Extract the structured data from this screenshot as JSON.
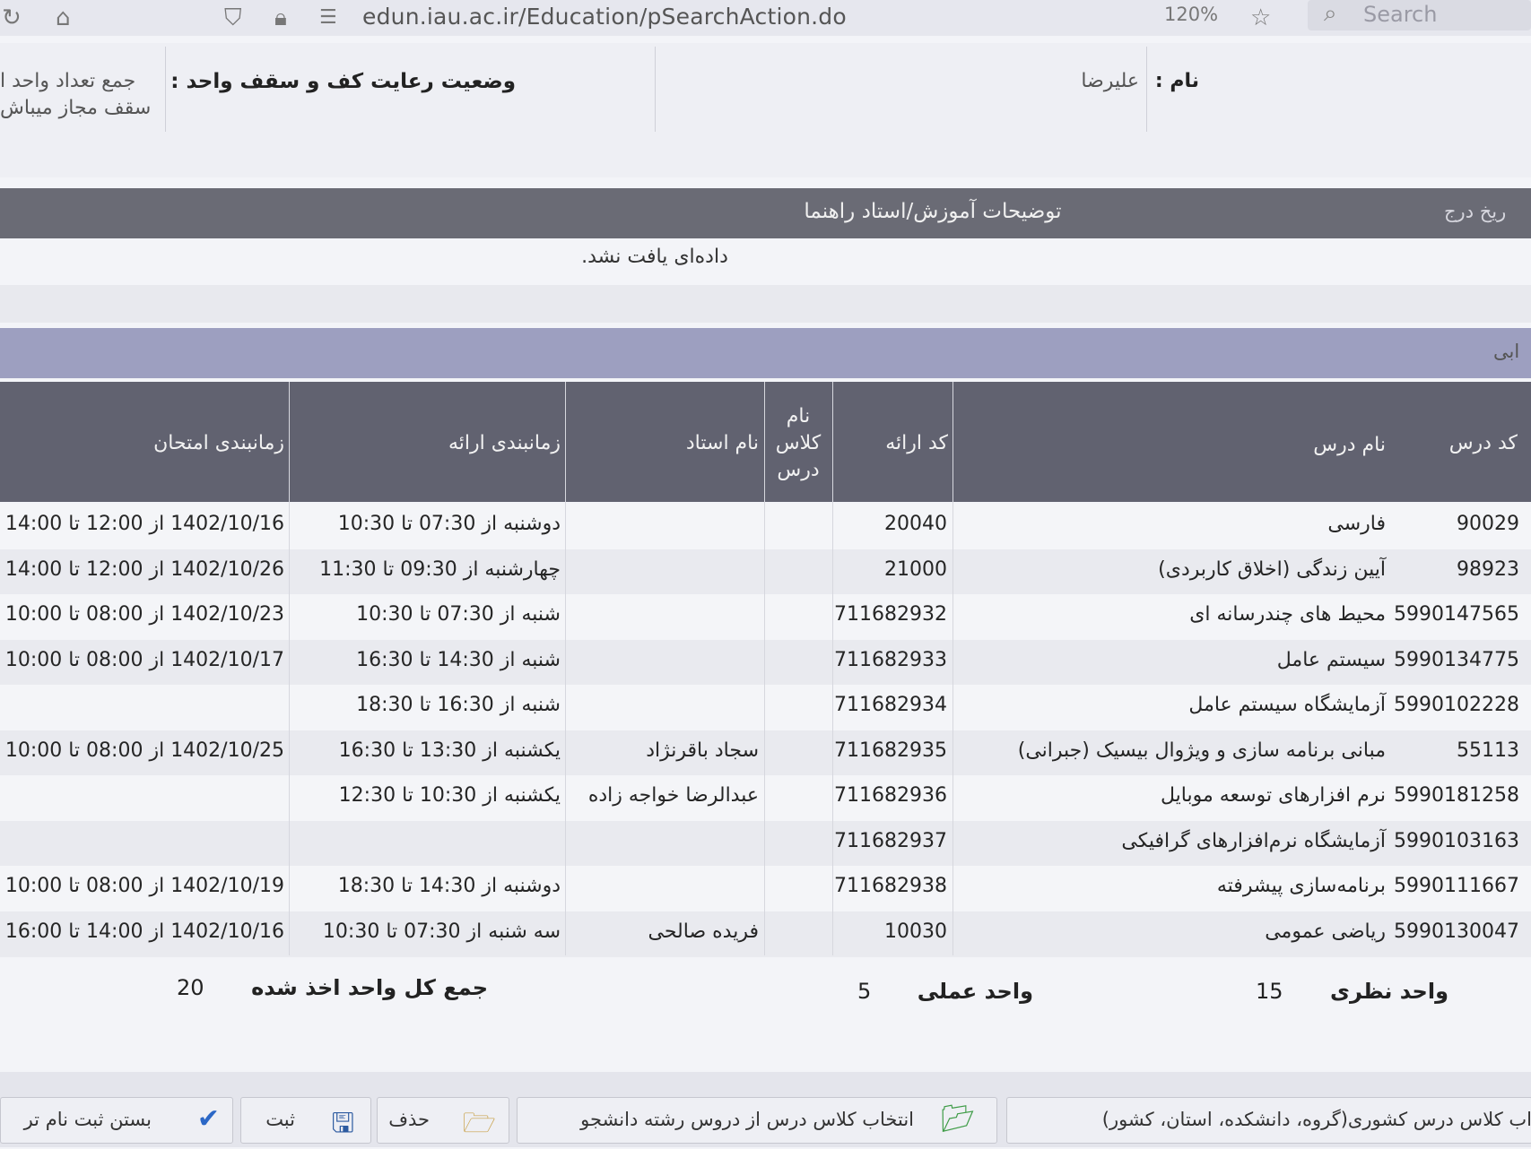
{
  "browser": {
    "url": "edun.iau.ac.ir/Education/pSearchAction.do",
    "zoom": "120%",
    "search_placeholder": "Search"
  },
  "header": {
    "name_label": "نام :",
    "name_value": "علیرضا",
    "status_label": "وضعیت رعایت کف و سقف واحد :",
    "sum_label_partial": "جمع تعداد واحد ا",
    "ceiling_partial": "سقف مجاز میباش"
  },
  "notes_bar": {
    "title": "توضیحات آموزش/استاد راهنما",
    "right_partial": "ریخ درج"
  },
  "no_data": "داده‌ای یافت نشد.",
  "section_label_partial": "ابی",
  "table": {
    "headers": {
      "course_code": "کد درس",
      "course_name": "نام درس",
      "offer_code": "کد ارائه",
      "class_name": "نام کلاس درس",
      "teacher": "نام استاد",
      "schedule": "زمانبندی ارائه",
      "exam": "زمانبندی امتحان"
    },
    "rows": [
      {
        "code": "90029",
        "name": "فارسی",
        "offer": "20040",
        "teacher": "",
        "schedule": "دوشنبه از 07:30 تا 10:30",
        "exam": "1402/10/16 از 12:00 تا 14:00"
      },
      {
        "code": "98923",
        "name": "آیین زندگی (اخلاق کاربردی)",
        "offer": "21000",
        "teacher": "",
        "schedule": "چهارشنبه از 09:30 تا 11:30",
        "exam": "1402/10/26 از 12:00 تا 14:00"
      },
      {
        "code": "5990147565",
        "name": "محیط های چندرسانه ای",
        "offer": "711682932",
        "teacher": "",
        "schedule": "شنبه از 07:30 تا 10:30",
        "exam": "1402/10/23 از 08:00 تا 10:00"
      },
      {
        "code": "5990134775",
        "name": "سیستم عامل",
        "offer": "711682933",
        "teacher": "",
        "schedule": "شنبه از 14:30 تا 16:30",
        "exam": "1402/10/17 از 08:00 تا 10:00"
      },
      {
        "code": "5990102228",
        "name": "آزمایشگاه سیستم عامل",
        "offer": "711682934",
        "teacher": "",
        "schedule": "شنبه از 16:30 تا 18:30",
        "exam": ""
      },
      {
        "code": "55113",
        "name": "مبانی برنامه سازی و ویژوال بیسیک (جبرانی)",
        "offer": "711682935",
        "teacher": "سجاد باقرنژاد",
        "schedule": "یکشنبه از 13:30 تا 16:30",
        "exam": "1402/10/25 از 08:00 تا 10:00"
      },
      {
        "code": "5990181258",
        "name": "نرم افزارهای توسعه موبایل",
        "offer": "711682936",
        "teacher": "عبدالرضا خواجه زاده",
        "schedule": "یکشنبه از 10:30 تا 12:30",
        "exam": ""
      },
      {
        "code": "5990103163",
        "name": "آزمایشگاه نرم‌افزارهای گرافیکی",
        "offer": "711682937",
        "teacher": "",
        "schedule": "",
        "exam": ""
      },
      {
        "code": "5990111667",
        "name": "برنامه‌سازی پیشرفته",
        "offer": "711682938",
        "teacher": "",
        "schedule": "دوشنبه از 14:30 تا 18:30",
        "exam": "1402/10/19 از 08:00 تا 10:00"
      },
      {
        "code": "5990130047",
        "name": "ریاضی عمومی",
        "offer": "10030",
        "teacher": "فریده صالحی",
        "schedule": "سه شنبه از 07:30 تا 10:30",
        "exam": "1402/10/16 از 14:00 تا 16:00"
      }
    ]
  },
  "totals": {
    "theory_label": "واحد نظری",
    "theory_value": "15",
    "practical_label": "واحد عملی",
    "practical_value": "5",
    "total_label": "جمع کل واحد اخذ شده",
    "total_value": "20"
  },
  "actions": {
    "national_class": "اب کلاس درس کشوری(گروه، دانشکده، استان، کشور)",
    "select_class": "انتخاب کلاس درس از دروس رشته دانشجو",
    "delete": "حذف",
    "save": "ثبت",
    "close_registration": "بستن ثبت نام تر"
  },
  "colors": {
    "header_dark": "#616270",
    "section_blue": "#9d9fc0",
    "row_light": "#f4f5f8",
    "row_alt": "#e9eaef"
  }
}
